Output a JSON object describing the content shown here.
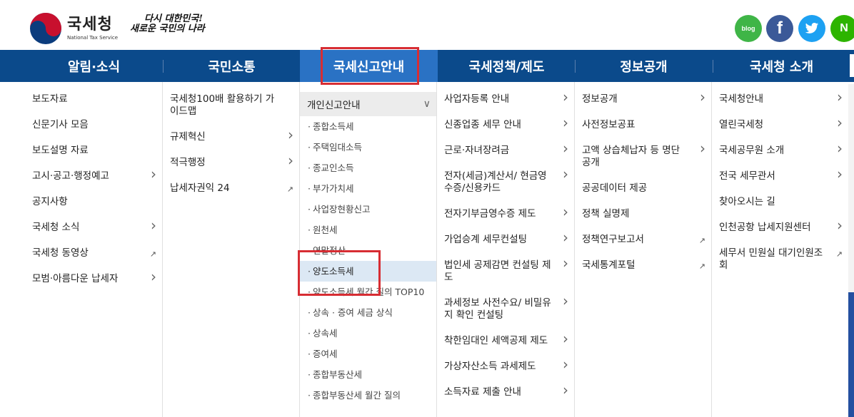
{
  "brand": {
    "name": "국세청",
    "name_en": "National Tax Service",
    "slogan_line1": "다시 대한민국!",
    "slogan_line2": "새로운 국민의 나라"
  },
  "social": [
    {
      "icon": "blog-icon",
      "label": "blog",
      "color": "#3fb547"
    },
    {
      "icon": "facebook-icon",
      "label": "f",
      "color": "#3b5998"
    },
    {
      "icon": "twitter-icon",
      "label": "t",
      "color": "#1da1f2"
    },
    {
      "icon": "naver-post-icon",
      "label": "N",
      "color": "#2db400"
    }
  ],
  "nav": [
    {
      "label": "알림·소식"
    },
    {
      "label": "국민소통"
    },
    {
      "label": "국세신고안내"
    },
    {
      "label": "국세정책/제도"
    },
    {
      "label": "정보공개"
    },
    {
      "label": "국세청 소개"
    }
  ],
  "columns": {
    "news": [
      {
        "label": "보도자료",
        "icon": ""
      },
      {
        "label": "신문기사 모음",
        "icon": ""
      },
      {
        "label": "보도설명 자료",
        "icon": ""
      },
      {
        "label": "고시·공고·행정예고",
        "icon": "chevron-right-icon"
      },
      {
        "label": "공지사항",
        "icon": ""
      },
      {
        "label": "국세청 소식",
        "icon": "chevron-right-icon"
      },
      {
        "label": "국세청 동영상",
        "icon": "external-link-icon"
      },
      {
        "label": "모범·아름다운 납세자",
        "icon": "chevron-right-icon"
      }
    ],
    "comm": [
      {
        "label": "국세청100배 활용하기 가이드맵",
        "icon": ""
      },
      {
        "label": "규제혁신",
        "icon": "chevron-right-icon"
      },
      {
        "label": "적극행정",
        "icon": "chevron-right-icon"
      },
      {
        "label": "납세자권익 24",
        "icon": "external-link-icon"
      }
    ],
    "filing_head": "개인신고안내",
    "filing": [
      "종합소득세",
      "주택임대소득",
      "종교인소득",
      "부가가치세",
      "사업장현황신고",
      "원천세",
      "연말정산",
      "양도소득세",
      "양도소득세 월간 질의 TOP10",
      "상속 · 증여 세금 상식",
      "상속세",
      "증여세",
      "종합부동산세",
      "종합부동산세 월간 질의"
    ],
    "policy": [
      "사업자등록 안내",
      "신종업종 세무 안내",
      "근로·자녀장려금",
      "전자(세금)계산서/ 현금영수증/신용카드",
      "전자기부금영수증 제도",
      "가업승계 세무컨설팅",
      "법인세 공제감면 컨설팅 제도",
      "과세정보 사전수요/ 비밀유지 확인 컨설팅",
      "착한임대인 세액공제 제도",
      "가상자산소득 과세제도",
      "소득자료 제출 안내"
    ],
    "info": [
      {
        "label": "정보공개",
        "icon": "chevron-right-icon"
      },
      {
        "label": "사전정보공표",
        "icon": ""
      },
      {
        "label": "고액 상습체납자 등 명단 공개",
        "icon": "chevron-right-icon"
      },
      {
        "label": "공공데이터 제공",
        "icon": ""
      },
      {
        "label": "정책 실명제",
        "icon": ""
      },
      {
        "label": "정책연구보고서",
        "icon": "external-link-icon"
      },
      {
        "label": "국세통계포털",
        "icon": "external-link-icon"
      }
    ],
    "about": [
      {
        "label": "국세청안내",
        "icon": "chevron-right-icon"
      },
      {
        "label": "열린국세청",
        "icon": "chevron-right-icon"
      },
      {
        "label": "국세공무원 소개",
        "icon": "chevron-right-icon"
      },
      {
        "label": "전국 세무관서",
        "icon": "chevron-right-icon"
      },
      {
        "label": "찾아오시는 길",
        "icon": ""
      },
      {
        "label": "인천공항 납세지원센터",
        "icon": "chevron-right-icon"
      },
      {
        "label": "세무서 민원실 대기인원조회",
        "icon": "external-link-icon"
      }
    ]
  },
  "colors": {
    "nav_bg": "#0b4a8b",
    "nav_active": "#2a72c4",
    "highlight": "#d72d33",
    "selected_bg": "#dce8f4"
  }
}
